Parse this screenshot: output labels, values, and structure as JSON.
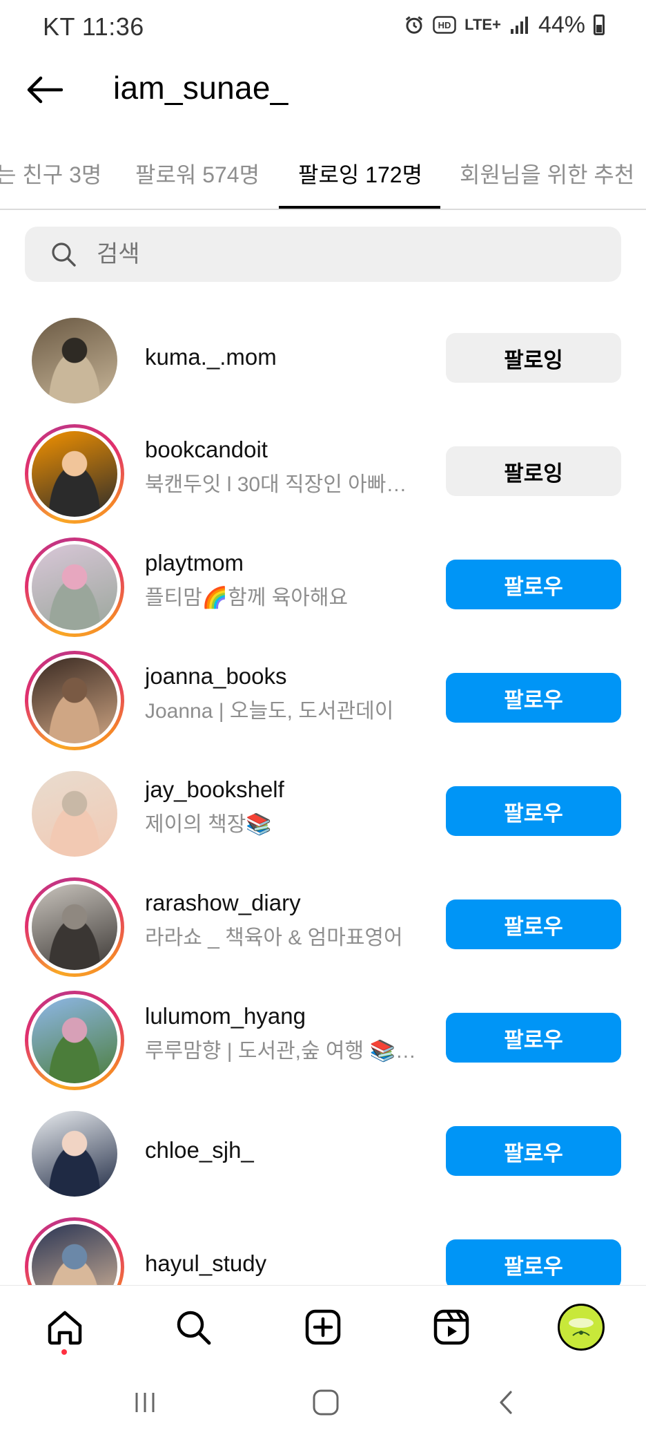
{
  "status_bar": {
    "carrier_time": "KT 11:36",
    "network": "LTE+",
    "battery": "44%"
  },
  "header": {
    "title": "iam_sunae_"
  },
  "tabs": [
    {
      "label": "는 친구 3명"
    },
    {
      "label": "팔로워 574명"
    },
    {
      "label": "팔로잉 172명",
      "active": true
    },
    {
      "label": "회원님을 위한 추천"
    }
  ],
  "search": {
    "placeholder": "검색"
  },
  "accounts": [
    {
      "username": "kuma._.mom",
      "subtitle": "",
      "button": "팔로잉",
      "state": "following",
      "ring": false,
      "avatar_colors": [
        "#6b5a44",
        "#c9b79a",
        "#2e2a24"
      ]
    },
    {
      "username": "bookcandoit",
      "subtitle": "북캔두잇 l 30대 직장인 아빠…",
      "button": "팔로잉",
      "state": "following",
      "ring": true,
      "avatar_colors": [
        "#f39200",
        "#2b2b2b",
        "#f1c59a"
      ]
    },
    {
      "username": "playtmom",
      "subtitle": "플티맘🌈함께 육아해요",
      "button": "팔로우",
      "state": "follow",
      "ring": true,
      "avatar_colors": [
        "#d9c7d8",
        "#9aa69b",
        "#e7a7bf"
      ]
    },
    {
      "username": "joanna_books",
      "subtitle": "Joanna | 오늘도, 도서관데이",
      "button": "팔로우",
      "state": "follow",
      "ring": true,
      "avatar_colors": [
        "#3a2a22",
        "#cfa684",
        "#7a5a44"
      ]
    },
    {
      "username": "jay_bookshelf",
      "subtitle": "제이의 책장📚",
      "button": "팔로우",
      "state": "follow",
      "ring": false,
      "avatar_colors": [
        "#e8dccf",
        "#f2c9b3",
        "#c8b8a6"
      ]
    },
    {
      "username": "rarashow_diary",
      "subtitle": "라라쇼 _ 책육아 & 엄마표영어",
      "button": "팔로우",
      "state": "follow",
      "ring": true,
      "avatar_colors": [
        "#c9c4bd",
        "#3a3633",
        "#8f8880"
      ]
    },
    {
      "username": "lulumom_hyang",
      "subtitle": "루루맘향 | 도서관,숲 여행 📚…",
      "button": "팔로우",
      "state": "follow",
      "ring": true,
      "avatar_colors": [
        "#8fb7e8",
        "#4b7d3a",
        "#d7a0b7"
      ]
    },
    {
      "username": "chloe_sjh_",
      "subtitle": "",
      "button": "팔로우",
      "state": "follow",
      "ring": false,
      "avatar_colors": [
        "#e9ecef",
        "#1f2a44",
        "#f1d4c4"
      ]
    },
    {
      "username": "hayul_study",
      "subtitle": "",
      "button": "팔로우",
      "state": "follow",
      "ring": true,
      "avatar_colors": [
        "#2a3554",
        "#d8b89a",
        "#6b88a8"
      ]
    }
  ],
  "bottom_nav": {
    "items": [
      "home-icon",
      "search-icon",
      "create-icon",
      "reels-icon",
      "profile-avatar"
    ]
  },
  "system_nav": {
    "items": [
      "recents-icon",
      "home-button-icon",
      "back-icon"
    ]
  },
  "colors": {
    "follow_blue": "#0095f6",
    "following_gray": "#efefef",
    "secondary_text": "#8e8e8e"
  }
}
